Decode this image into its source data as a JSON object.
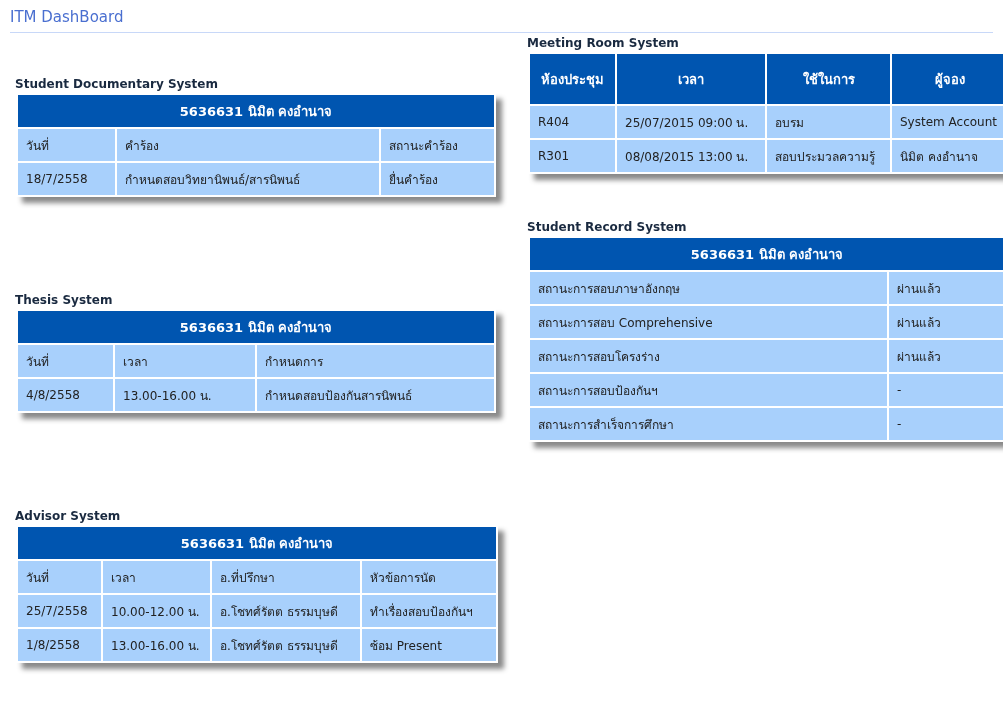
{
  "page_title": "ITM DashBoard",
  "left": [
    {
      "title": "Student Documentary System",
      "header": "5636631 นิมิต คงอำนาจ",
      "columns": [
        "วันที่",
        "คำร้อง",
        "สถานะคำร้อง"
      ],
      "rows": [
        [
          "18/7/2558",
          "กำหนดสอบวิทยานิพนธ์/สารนิพนธ์",
          "ยื่นคำร้อง"
        ]
      ]
    },
    {
      "title": "Thesis System",
      "header": "5636631 นิมิต คงอำนาจ",
      "columns": [
        "วันที่",
        "เวลา",
        "กำหนดการ"
      ],
      "rows": [
        [
          "4/8/2558",
          "13.00-16.00 น.",
          "กำหนดสอบป้องกันสารนิพนธ์"
        ]
      ]
    },
    {
      "title": "Advisor System",
      "header": "5636631 นิมิต คงอำนาจ",
      "columns": [
        "วันที่",
        "เวลา",
        "อ.ที่ปรึกษา",
        "หัวข้อการนัด"
      ],
      "rows": [
        [
          "25/7/2558",
          "10.00-12.00 น.",
          "อ.โชทศ์รัตต ธรรมบุษดี",
          "ทำเรื่องสอบป้องกันฯ"
        ],
        [
          "1/8/2558",
          "13.00-16.00 น.",
          "อ.โชทศ์รัตต ธรรมบุษดี",
          "ซ้อม Present"
        ]
      ]
    }
  ],
  "right": [
    {
      "title": "Meeting Room System",
      "heading_columns": [
        "ห้องประชุม",
        "เวลา",
        "ใช้ในการ",
        "ผู้จอง"
      ],
      "rows": [
        [
          "R404",
          "25/07/2015 09:00 น.",
          "อบรม",
          "System Account"
        ],
        [
          "R301",
          "08/08/2015 13:00 น.",
          "สอบประมวลความรู้",
          "นิมิต คงอำนาจ"
        ]
      ]
    },
    {
      "title": "Student Record System",
      "header": "5636631 นิมิต คงอำนาจ",
      "rows": [
        [
          "สถานะการสอบภาษาอังกฤษ",
          "ผ่านแล้ว"
        ],
        [
          "สถานะการสอบ Comprehensive",
          "ผ่านแล้ว"
        ],
        [
          "สถานะการสอบโครงร่าง",
          "ผ่านแล้ว"
        ],
        [
          "สถานะการสอบป้องกันฯ",
          "-"
        ],
        [
          "สถานะการสำเร็จการศึกษา",
          "-"
        ]
      ]
    }
  ]
}
